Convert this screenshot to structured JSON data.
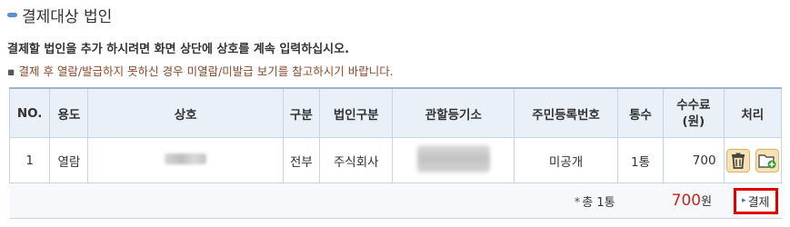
{
  "section": {
    "title": "결제대상 법인"
  },
  "description": "결제할 법인을 추가 하시려면 화면 상단에 상호를 계속 입력하십시오.",
  "note": {
    "bullet": "▪",
    "text": "결제 후 열람/발급하지 못하신 경우 미열람/미발급 보기를 참고하시기 바랍니다."
  },
  "table": {
    "headers": [
      "NO.",
      "용도",
      "상호",
      "구분",
      "법인구분",
      "관할등기소",
      "주민등록번호",
      "통수",
      "수수료\n(원)",
      "처리"
    ],
    "rows": [
      {
        "no": "1",
        "purpose": "열람",
        "type": "전부",
        "corp_type": "주식회사",
        "resident_no": "미공개",
        "copies": "1통",
        "fee": "700"
      }
    ]
  },
  "footer": {
    "total_count": "총 1통",
    "total_amount": "700",
    "currency": "원",
    "pay_label": "결제"
  },
  "colors": {
    "accent": "#5a8fd0",
    "total": "#c0281f",
    "highlight_border": "#e00000",
    "note": "#8b4a2a"
  }
}
